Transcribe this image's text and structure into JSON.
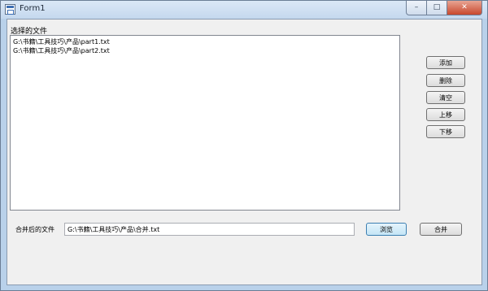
{
  "window": {
    "title": "Form1",
    "controls": {
      "minimize": "–",
      "maximize": "□",
      "close": "✕"
    }
  },
  "files": {
    "label": "选择的文件",
    "items": [
      "G:\\书籍\\工具技巧\\产品\\part1.txt",
      "G:\\书籍\\工具技巧\\产品\\part2.txt"
    ]
  },
  "buttons": {
    "add": "添加",
    "delete": "删除",
    "clear": "清空",
    "move_up": "上移",
    "move_down": "下移",
    "browse": "浏览",
    "merge": "合并"
  },
  "merge": {
    "label": "合并后的文件",
    "value": "G:\\书籍\\工具技巧\\产品\\合并.txt"
  }
}
